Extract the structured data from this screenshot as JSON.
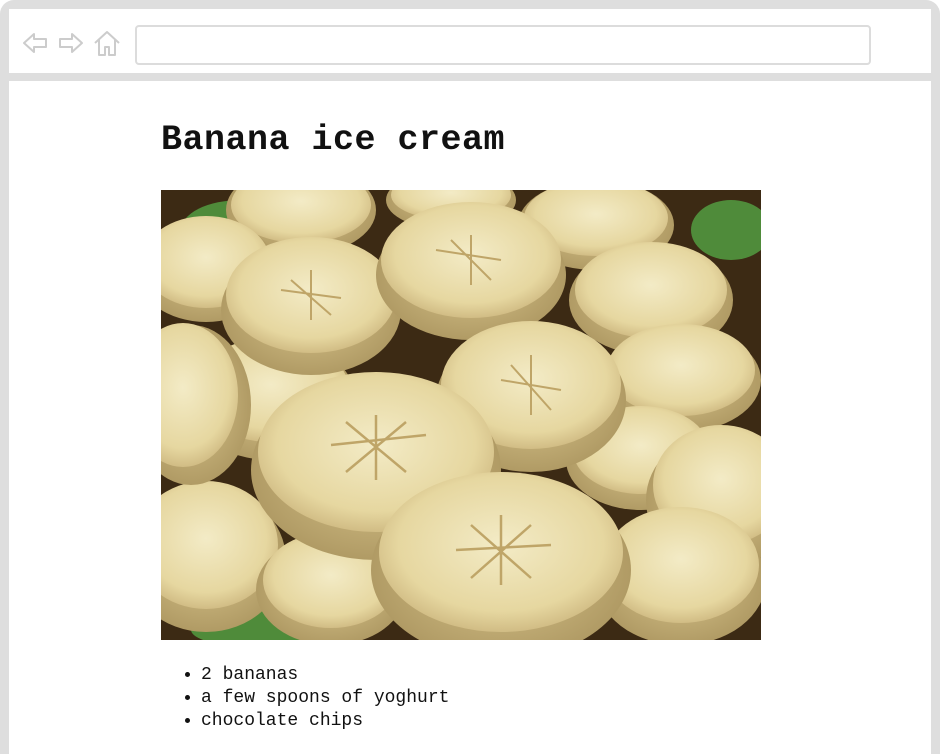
{
  "browser": {
    "address_value": "",
    "icons": [
      "back-arrow-icon",
      "forward-arrow-icon",
      "home-icon"
    ]
  },
  "page": {
    "title": "Banana ice cream",
    "image_subject": "banana-slices-photo",
    "ingredients": [
      "2 bananas",
      "a few spoons of yoghurt",
      "chocolate chips"
    ]
  },
  "colors": {
    "frame": "#dedede",
    "address_border": "#dcdcdc",
    "icon_stroke": "#cccccc",
    "text": "#111111",
    "banana_flesh": "#ece0b0",
    "banana_shadow": "#c9b27a",
    "background_dark": "#3c2a14",
    "plate_green": "#4f8b3a"
  }
}
